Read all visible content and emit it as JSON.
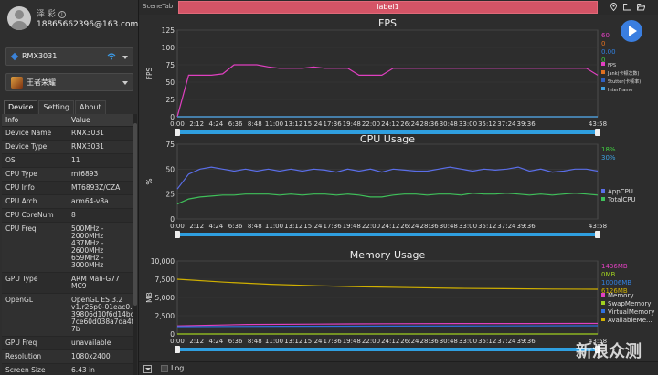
{
  "user": {
    "name": "泽 彩",
    "email": "18865662396@163.com"
  },
  "device_select": {
    "value": "RMX3031"
  },
  "app_select": {
    "value": "王者荣耀"
  },
  "tabs": [
    "Device",
    "Setting",
    "About"
  ],
  "table": {
    "headers": [
      "Info",
      "Value"
    ],
    "rows": [
      [
        "Device Name",
        "RMX3031"
      ],
      [
        "Device Type",
        "RMX3031"
      ],
      [
        "OS",
        "11"
      ],
      [
        "CPU Type",
        "mt6893"
      ],
      [
        "CPU Info",
        "MT6893Z/CZA"
      ],
      [
        "CPU Arch",
        "arm64-v8a"
      ],
      [
        "CPU CoreNum",
        "8"
      ],
      [
        "CPU Freq",
        "500MHz -\n2000MHz\n437MHz -\n2600MHz\n659MHz -\n3000MHz"
      ],
      [
        "GPU Type",
        "ARM Mali-G77\nMC9"
      ],
      [
        "OpenGL",
        "OpenGL ES 3.2\nv1.r26p0-01eac0.\n39806d10f6d14bd\n7ce60d038a7da4f\n7b"
      ],
      [
        "GPU Freq",
        "unavailable"
      ],
      [
        "Resolution",
        "1080x2400"
      ],
      [
        "Screen Size",
        "6.43 in"
      ]
    ]
  },
  "topbar": {
    "scene_tab": "SceneTab",
    "label": "label1"
  },
  "bottombar": {
    "log_label": "Log",
    "watermark": "新浪众测"
  },
  "colors": {
    "accent": "#3a7ee0",
    "label_bar": "#d45466",
    "fps": "#e040c0",
    "fps_spike": "#2f8fe0",
    "cpu_app": "#5a6ee8",
    "cpu_total": "#3fc05a",
    "mem": "#d0b000",
    "slider": "#2f9fe0"
  },
  "chart_data": [
    {
      "type": "line",
      "title": "FPS",
      "ylabel": "FPS",
      "ylim": [
        0,
        125
      ],
      "yticks": [
        0,
        25,
        50,
        75,
        100,
        125
      ],
      "xticks": [
        "0:00",
        "2:12",
        "4:24",
        "6:36",
        "8:48",
        "11:00",
        "13:12",
        "15:24",
        "17:36",
        "19:48",
        "22:00",
        "24:12",
        "26:24",
        "28:36",
        "30:48",
        "33:00",
        "35:12",
        "37:24",
        "39:36",
        "43:58"
      ],
      "values_box": [
        "60",
        "0",
        "0.00",
        "0"
      ],
      "series": [
        {
          "name": "FPS",
          "values": [
            0,
            60,
            60,
            60,
            62,
            75,
            75,
            75,
            72,
            70,
            70,
            70,
            72,
            70,
            70,
            70,
            60,
            60,
            60,
            70,
            70,
            70,
            70,
            70,
            70,
            70,
            70,
            70,
            70,
            70,
            70,
            70,
            70,
            70,
            70,
            70,
            70,
            60
          ]
        },
        {
          "name": "Jank(卡顿次数)",
          "values": [
            0,
            0
          ]
        },
        {
          "name": "Stutter(卡顿率)",
          "values": [
            0,
            0
          ]
        },
        {
          "name": "InterFrame",
          "values": [
            0,
            0
          ]
        }
      ]
    },
    {
      "type": "line",
      "title": "CPU Usage",
      "ylabel": "%",
      "ylim": [
        0,
        75
      ],
      "yticks": [
        0,
        25,
        50,
        75
      ],
      "xticks": [
        "0:00",
        "2:12",
        "4:24",
        "6:36",
        "8:48",
        "11:00",
        "13:12",
        "15:24",
        "17:36",
        "19:48",
        "22:00",
        "24:12",
        "26:24",
        "28:36",
        "30:48",
        "33:00",
        "35:12",
        "37:24",
        "39:36",
        "43:58"
      ],
      "values_box": [
        "18%",
        "30%"
      ],
      "series": [
        {
          "name": "AppCPU",
          "values": [
            30,
            45,
            50,
            52,
            50,
            48,
            50,
            48,
            50,
            48,
            50,
            48,
            50,
            49,
            47,
            50,
            48,
            50,
            47,
            50,
            49,
            48,
            48,
            50,
            52,
            50,
            48,
            50,
            49,
            50,
            52,
            48,
            50,
            47,
            48,
            50,
            50,
            48
          ]
        },
        {
          "name": "TotalCPU",
          "values": [
            15,
            20,
            22,
            23,
            24,
            24,
            25,
            25,
            25,
            24,
            25,
            24,
            25,
            25,
            24,
            25,
            24,
            22,
            22,
            24,
            25,
            25,
            24,
            25,
            25,
            24,
            26,
            25,
            25,
            26,
            25,
            24,
            25,
            24,
            25,
            26,
            25,
            24
          ]
        }
      ]
    },
    {
      "type": "line",
      "title": "Memory Usage",
      "ylabel": "MB",
      "ylim": [
        0,
        10000
      ],
      "yticks": [
        "0",
        "2,500",
        "5,000",
        "7,500",
        "10,000"
      ],
      "xticks": [
        "0:00",
        "2:12",
        "4:24",
        "6:36",
        "8:48",
        "11:00",
        "13:12",
        "15:24",
        "17:36",
        "19:48",
        "22:00",
        "24:12",
        "26:24",
        "28:36",
        "30:48",
        "33:00",
        "35:12",
        "37:24",
        "39:36",
        "43:58"
      ],
      "values_box": [
        "1436MB",
        "0MB",
        "10006MB",
        "6126MB"
      ],
      "series": [
        {
          "name": "Memory",
          "values": [
            1100,
            1300,
            1350,
            1400,
            1420,
            1430,
            1436
          ]
        },
        {
          "name": "SwapMemory",
          "values": [
            0,
            0
          ]
        },
        {
          "name": "VirtualMemory",
          "values": [
            1000,
            1050,
            1080,
            1100,
            1120
          ]
        },
        {
          "name": "AvailableMe...",
          "values": [
            7500,
            7100,
            6800,
            6600,
            6450,
            6350,
            6250,
            6200,
            6150,
            6126
          ]
        }
      ]
    }
  ]
}
